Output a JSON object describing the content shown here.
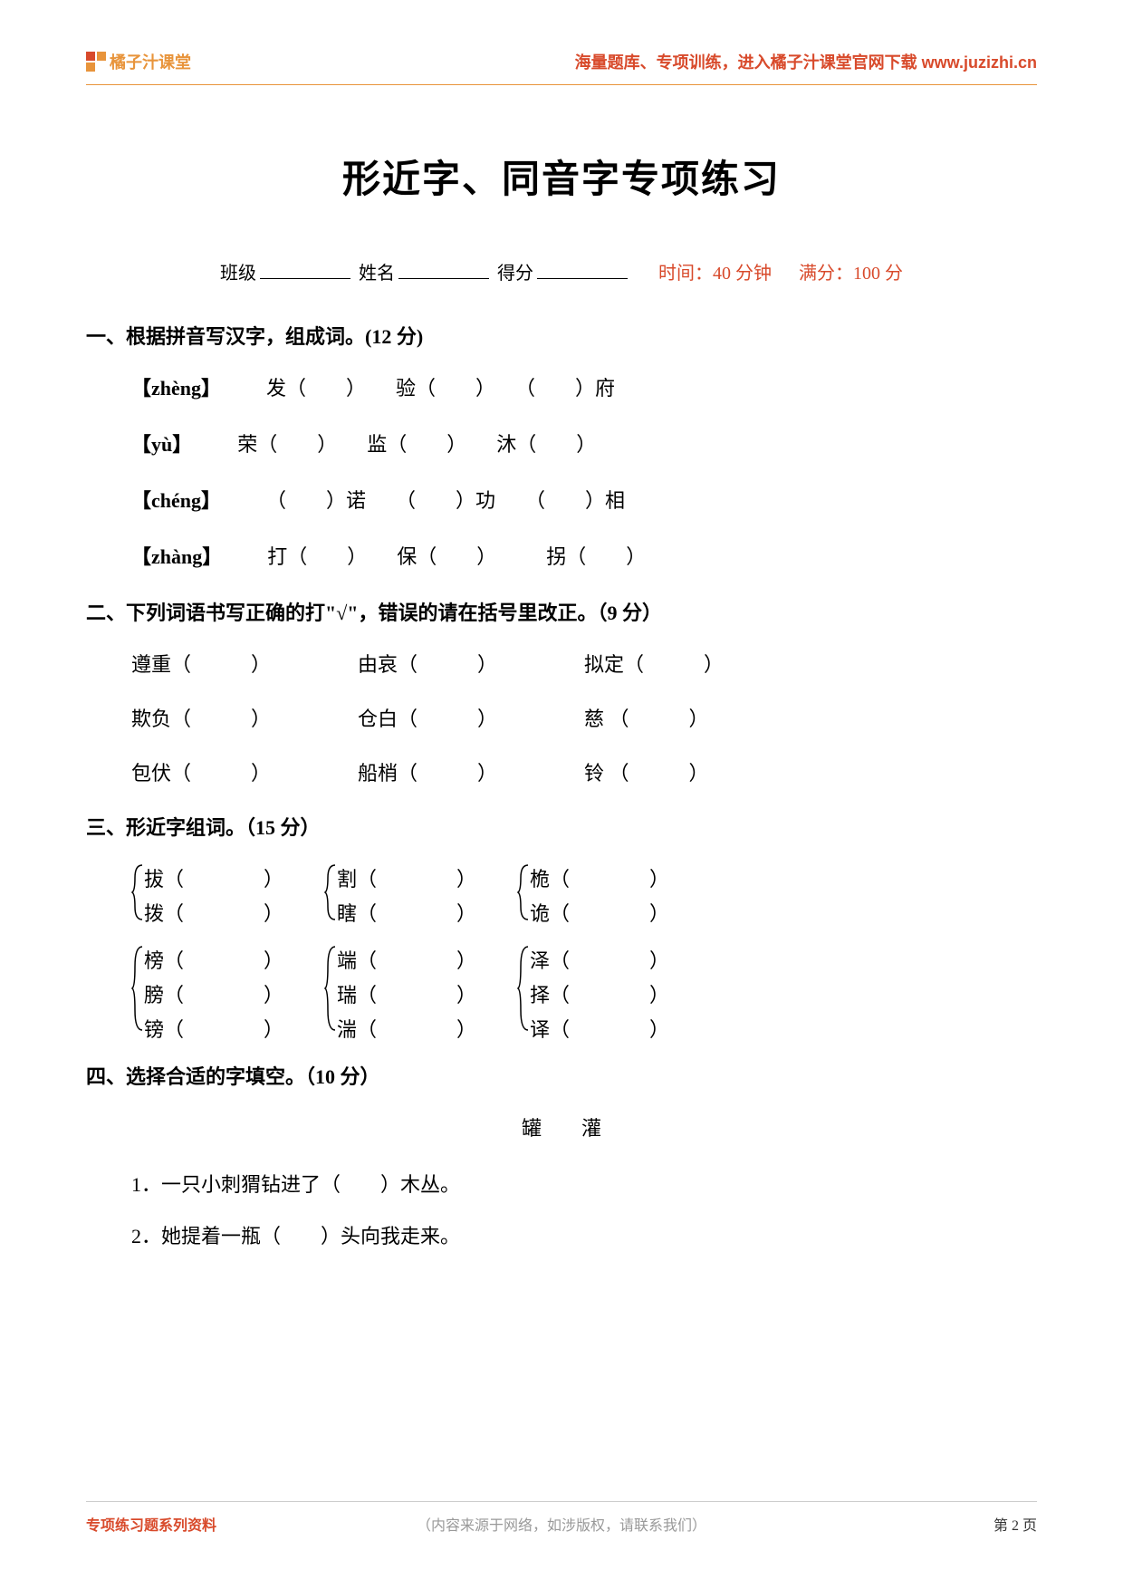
{
  "header": {
    "logo_text": "橘子汁课堂",
    "right_text": "海量题库、专项训练，进入橘子汁课堂官网下载 www.juzizhi.cn"
  },
  "title": "形近字、同音字专项练习",
  "info": {
    "class_label": "班级",
    "name_label": "姓名",
    "score_label": "得分",
    "time_label": "时间：40 分钟",
    "full_label": "满分：100 分"
  },
  "section1": {
    "title": "一、根据拼音写汉字，组成词。(12 分)",
    "rows": [
      {
        "pinyin": "【zhèng】",
        "items": "发（　　）　　验（　　）　　（　　）府"
      },
      {
        "pinyin": "【yù】",
        "items": "荣（　　）　　监（　　）　　沐（　　）"
      },
      {
        "pinyin": "【chéng】",
        "items": "（　　）诺　　（　　）功　　（　　）相"
      },
      {
        "pinyin": "【zhàng】",
        "items": "打（　　）　　保（　　）　　　拐（　　）"
      }
    ]
  },
  "section2": {
    "title": "二、下列词语书写正确的打\"√\"，错误的请在括号里改正。（9 分）",
    "rows": [
      [
        {
          "w": "遵重（　　　）"
        },
        {
          "w": "由哀（　　　）"
        },
        {
          "w": "拟定（　　　）"
        }
      ],
      [
        {
          "w": "欺负（　　　）"
        },
        {
          "w": "仓白（　　　）"
        },
        {
          "w": "慈 （　　　）"
        }
      ],
      [
        {
          "w": "包伏（　　　）"
        },
        {
          "w": "船梢（　　　）"
        },
        {
          "w": "铃 （　　　）"
        }
      ]
    ]
  },
  "section3": {
    "title": "三、形近字组词。（15 分）",
    "row1": [
      [
        "拔（　　　　）",
        "拨（　　　　）"
      ],
      [
        "割（　　　　）",
        "瞎（　　　　）"
      ],
      [
        "桅（　　　　）",
        "诡（　　　　）"
      ]
    ],
    "row2": [
      [
        "榜（　　　　）",
        "膀（　　　　）",
        "镑（　　　　）"
      ],
      [
        "端（　　　　）",
        "瑞（　　　　）",
        "湍（　　　　）"
      ],
      [
        "泽（　　　　）",
        "择（　　　　）",
        "译（　　　　）"
      ]
    ]
  },
  "section4": {
    "title": "四、选择合适的字填空。（10 分）",
    "choices": "罐　　灌",
    "items": [
      "1．一只小刺猬钻进了（　　）木丛。",
      "2．她提着一瓶（　　）头向我走来。"
    ]
  },
  "footer": {
    "left": "专项练习题系列资料",
    "center": "（内容来源于网络，如涉版权，请联系我们）",
    "right": "第 2 页"
  }
}
